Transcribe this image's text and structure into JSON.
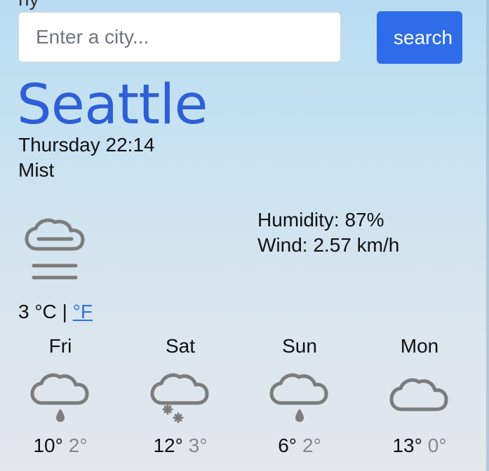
{
  "header": {
    "partial_top_text": "ny"
  },
  "search": {
    "placeholder": "Enter a city...",
    "button_label": "search"
  },
  "current": {
    "city": "Seattle",
    "datetime": "Thursday 22:14",
    "condition": "Mist",
    "temperature": "3",
    "unit_c": "°C",
    "divider": "|",
    "unit_f": "°F",
    "humidity": "Humidity: 87%",
    "wind": "Wind: 2.57 km/h",
    "icon": "mist-icon"
  },
  "forecast": [
    {
      "day": "Fri",
      "high": "10°",
      "low": "2°",
      "icon": "rain-cloud-icon"
    },
    {
      "day": "Sat",
      "high": "12°",
      "low": "3°",
      "icon": "snow-cloud-icon"
    },
    {
      "day": "Sun",
      "high": "6°",
      "low": "2°",
      "icon": "rain-cloud-icon"
    },
    {
      "day": "Mon",
      "high": "13°",
      "low": "0°",
      "icon": "cloud-icon"
    }
  ],
  "colors": {
    "accent_blue": "#2f6ce9",
    "city_blue": "#2f5fd6",
    "link_blue": "#2a73e8",
    "icon_gray": "#7c7c7c"
  }
}
